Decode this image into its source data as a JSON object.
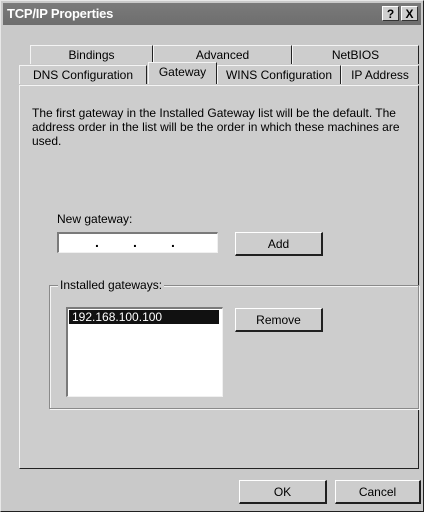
{
  "window": {
    "title": "TCP/IP Properties",
    "help_button": "?",
    "close_button": "X"
  },
  "tabs": {
    "row_back": [
      {
        "label": "Bindings"
      },
      {
        "label": "Advanced"
      },
      {
        "label": "NetBIOS"
      }
    ],
    "row_front": [
      {
        "label": "DNS Configuration"
      },
      {
        "label": "Gateway"
      },
      {
        "label": "WINS Configuration"
      },
      {
        "label": "IP Address"
      }
    ],
    "active": "Gateway"
  },
  "gateway_panel": {
    "description": "The first gateway in the Installed Gateway list will be the default. The address order in the list will be the order in which these machines are used.",
    "new_gateway_label": "New gateway:",
    "new_gateway_value": ".   .   .",
    "add_button": "Add",
    "installed_label": "Installed gateways:",
    "installed_gateways": [
      "192.168.100.100"
    ],
    "remove_button": "Remove"
  },
  "footer": {
    "ok_button": "OK",
    "cancel_button": "Cancel"
  }
}
